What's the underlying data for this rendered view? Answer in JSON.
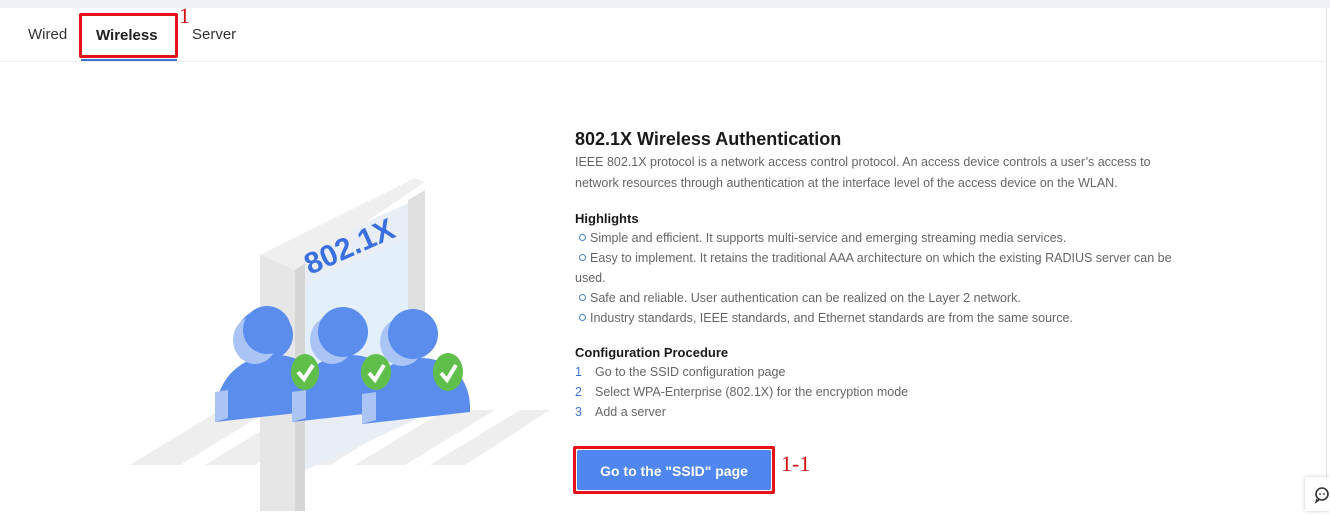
{
  "tabs": [
    {
      "label": "Wired"
    },
    {
      "label": "Wireless"
    },
    {
      "label": "Server"
    }
  ],
  "annotations": {
    "tab_marker": "1",
    "button_marker": "1-1"
  },
  "illustration": {
    "gate_label": "802.1X"
  },
  "main": {
    "title": "802.1X Wireless Authentication",
    "description_line1": "IEEE 802.1X protocol is a network access control protocol. An access device controls a user’s access to",
    "description_line2": "network resources through authentication at the interface level of the access device on the WLAN.",
    "highlights_heading": "Highlights",
    "highlights": [
      "Simple and efficient. It supports multi-service and emerging streaming media services.",
      "Easy to implement. It retains the traditional AAA architecture on which the existing RADIUS server can be",
      "used.",
      "Safe and reliable. User authentication can be realized on the Layer 2 network.",
      "Industry standards, IEEE standards, and Ethernet standards are from the same source."
    ],
    "procedure_heading": "Configuration Procedure",
    "steps": [
      {
        "num": "1",
        "text": "Go to the SSID configuration page"
      },
      {
        "num": "2",
        "text": "Select WPA-Enterprise (802.1X) for the encryption mode"
      },
      {
        "num": "3",
        "text": "Add a server"
      }
    ],
    "button_label": "Go to the \"SSID\" page"
  },
  "colors": {
    "accent": "#3d73d6",
    "button": "#4f86ef",
    "annotation": "#e3131b",
    "check": "#5fbf4a"
  }
}
